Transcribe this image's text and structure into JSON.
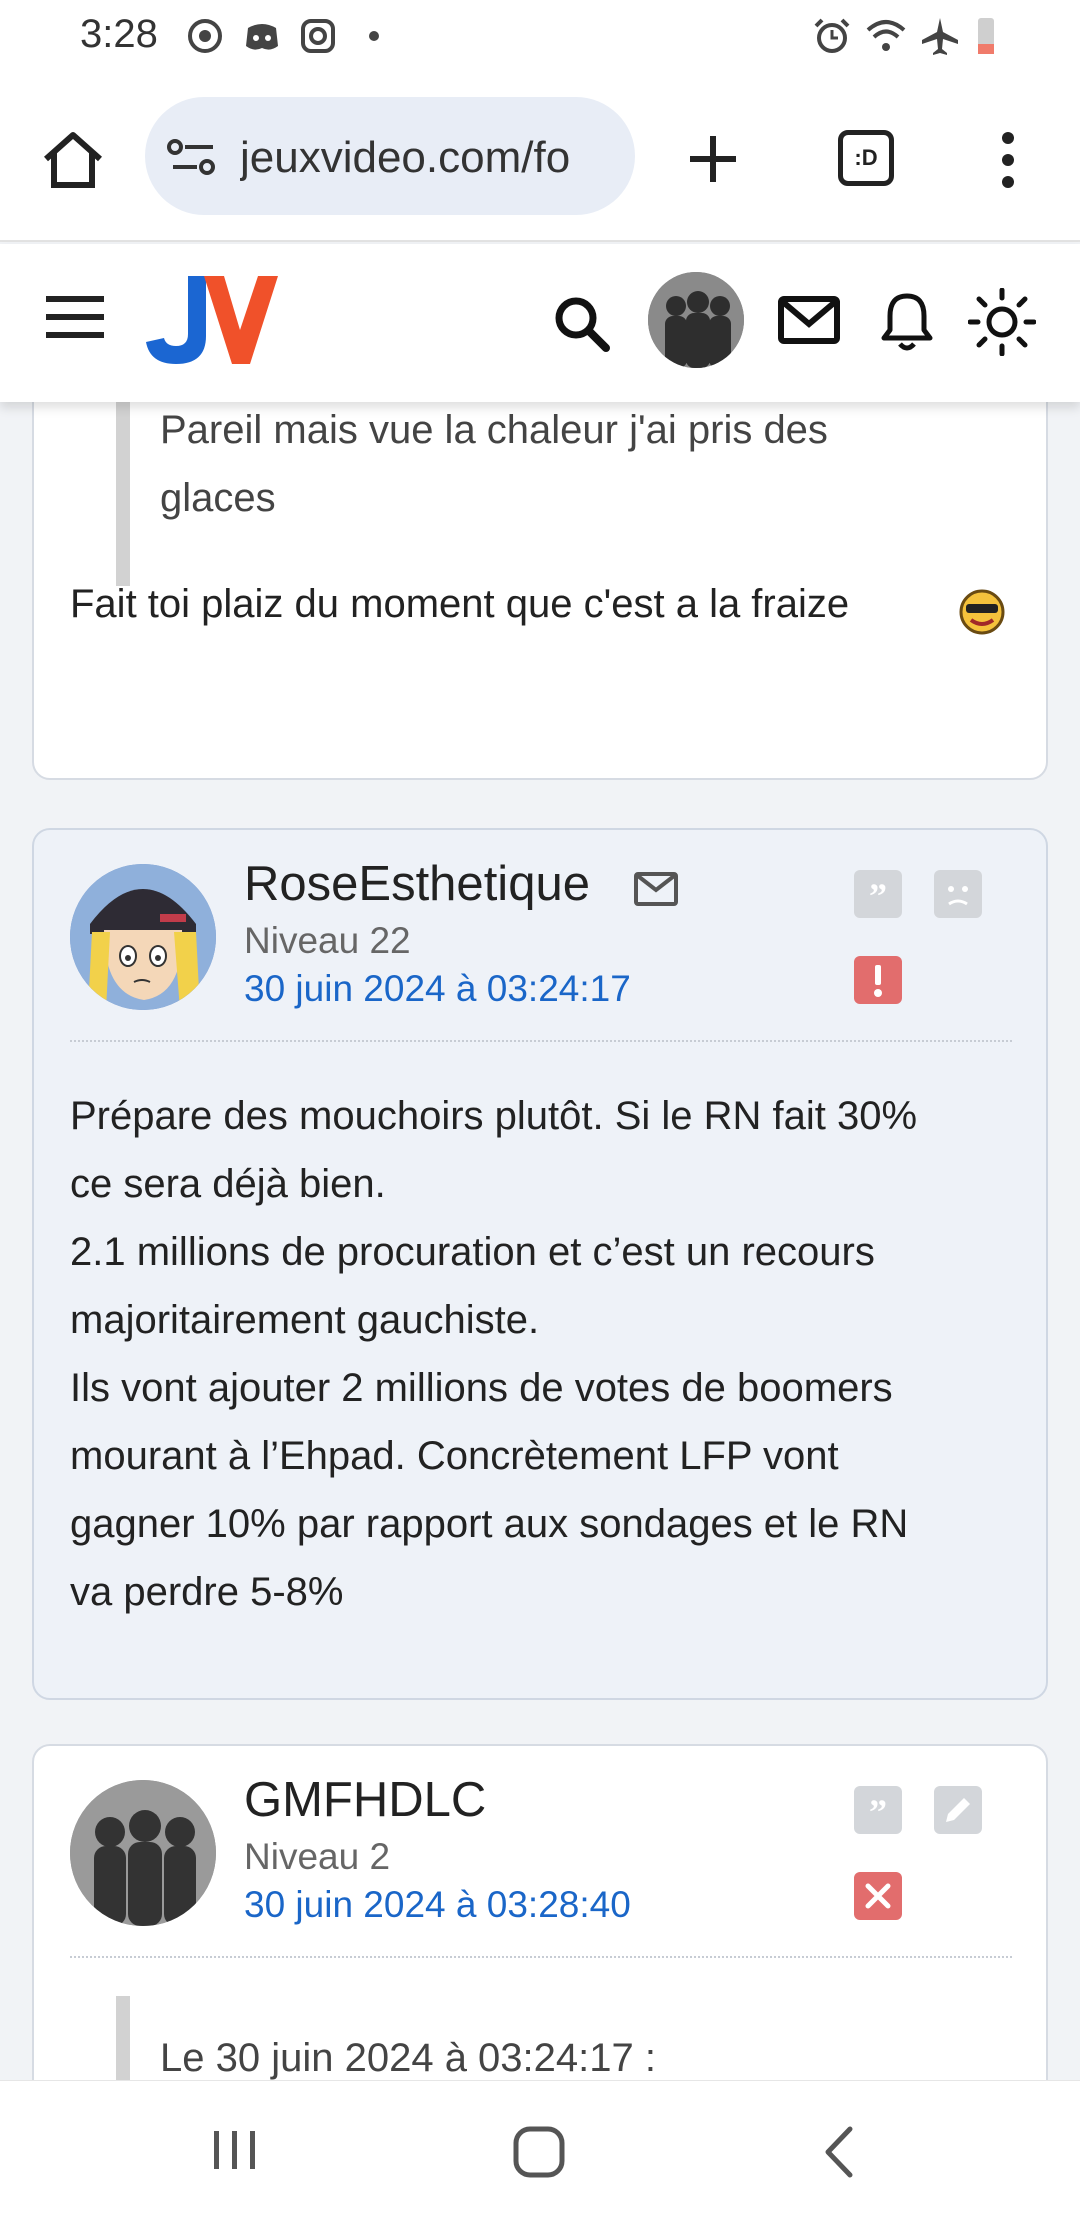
{
  "status_bar": {
    "time": "3:28",
    "left_icons": [
      "sync-icon",
      "discord-icon",
      "instagram-icon",
      "dot-icon"
    ],
    "right_icons": [
      "alarm-icon",
      "wifi-icon",
      "airplane-icon",
      "battery-low-icon"
    ]
  },
  "browser": {
    "url": "jeuxvideo.com/fo",
    "tab_count_label": ":D"
  },
  "site_header": {
    "logo_text": "JV",
    "icons": [
      "menu-icon",
      "search-icon",
      "avatar",
      "mail-icon",
      "bell-icon",
      "sun-icon"
    ]
  },
  "posts": [
    {
      "quote_lines": [
        "Pareil mais vue la chaleur j'ai pris des",
        "glaces"
      ],
      "text": "Fait toi plaiz du moment que c'est a la fraize"
    },
    {
      "pseudo": "RoseEsthetique",
      "level": "Niveau 22",
      "date": "30 juin 2024 à 03:24:17",
      "lines": [
        "Prépare des mouchoirs plutôt. Si le RN fait 30%",
        "ce sera déjà bien.",
        "2.1 millions de procuration et c’est un recours",
        "majoritairement gauchiste.",
        "Ils vont ajouter 2 millions de votes de boomers",
        "mourant à l’Ehpad. Concrètement LFP vont",
        "gagner 10% par rapport aux sondages et le RN",
        "va perdre 5-8%"
      ]
    },
    {
      "pseudo": "GMFHDLC",
      "level": "Niveau 2",
      "date": "30 juin 2024 à 03:28:40",
      "quote_header": "Le 30 juin 2024 à 03:24:17 :"
    }
  ],
  "colors": {
    "accent_blue": "#1a66c8",
    "alert_red": "#e26d6d",
    "action_grey": "#d3d6da"
  }
}
